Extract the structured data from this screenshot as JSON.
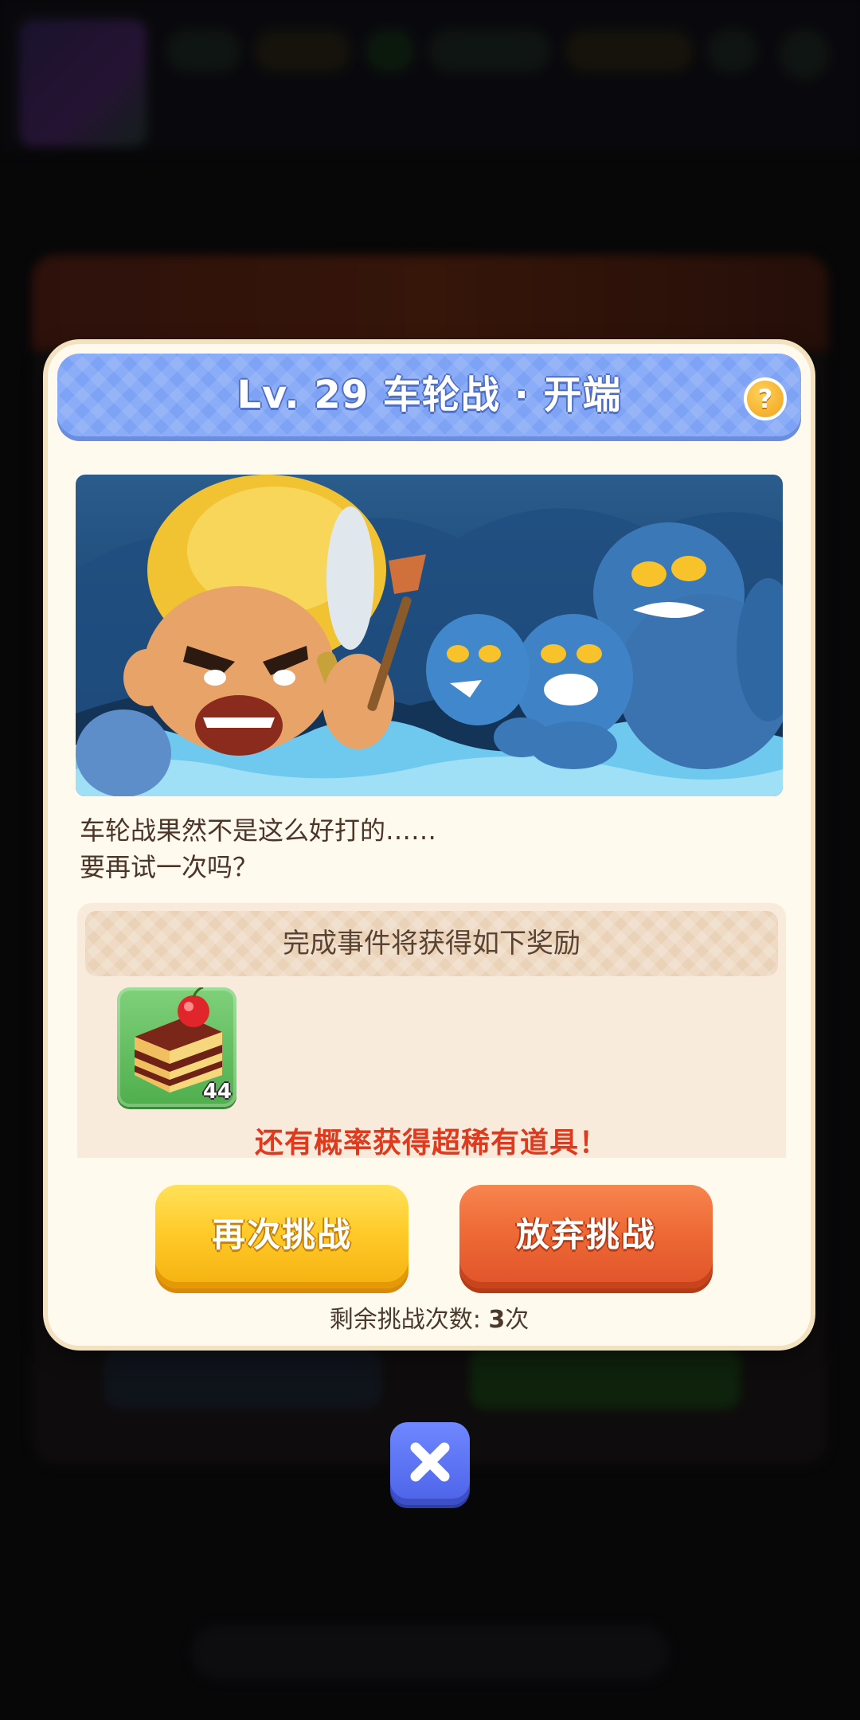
{
  "dialog": {
    "title": "Lv. 29 车轮战 · 开端",
    "help_icon": "question-mark-icon",
    "help_glyph": "?",
    "story_line_1": "车轮战果然不是这么好打的……",
    "story_line_2": "要再试一次吗？",
    "reward": {
      "heading": "完成事件将获得如下奖励",
      "item_icon": "cherry-cake-icon",
      "item_count": "44",
      "rare_note": "还有概率获得超稀有道具！"
    },
    "buttons": {
      "retry": "再次挑战",
      "give_up": "放弃挑战"
    },
    "remaining_label": "剩余挑战次数:",
    "remaining_count": "3",
    "remaining_unit": "次",
    "close_icon": "close-x-icon"
  },
  "colors": {
    "header_blue": "#7ea3f5",
    "dialog_bg": "#fff9ee",
    "retry_yellow": "#ffcb2a",
    "give_up_orange": "#ee6a36",
    "rare_red": "#e03a1e",
    "close_blue": "#5b73f2"
  }
}
